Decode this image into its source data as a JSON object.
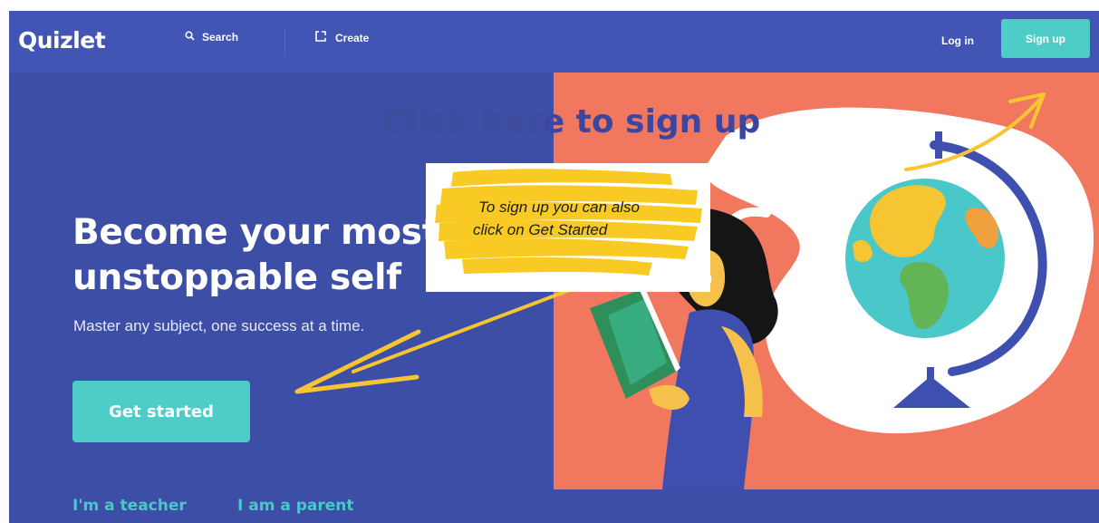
{
  "nav": {
    "logo": "Quizlet",
    "search_label": "Search",
    "create_label": "Create",
    "login_label": "Log in",
    "signup_label": "Sign up"
  },
  "hero": {
    "headline_line1": "Become your most",
    "headline_line2": "unstoppable self",
    "subtitle": "Master any subject, one success at a time.",
    "cta_label": "Get started",
    "teacher_link": "I'm a teacher",
    "parent_link": "I am a parent"
  },
  "annotation": {
    "heading_hidden": "Click her",
    "heading_visible": "e to sign up",
    "callout_line1": "To sign up you can also",
    "callout_line2": "click on Get Started"
  },
  "colors": {
    "nav_bg": "#4255b5",
    "hero_bg": "#3d4ea6",
    "accent_teal": "#4ecdc8",
    "illustration_bg": "#f1785f",
    "highlight_yellow": "#f9c818"
  },
  "icons": {
    "search": "search-icon",
    "create": "create-icon"
  }
}
